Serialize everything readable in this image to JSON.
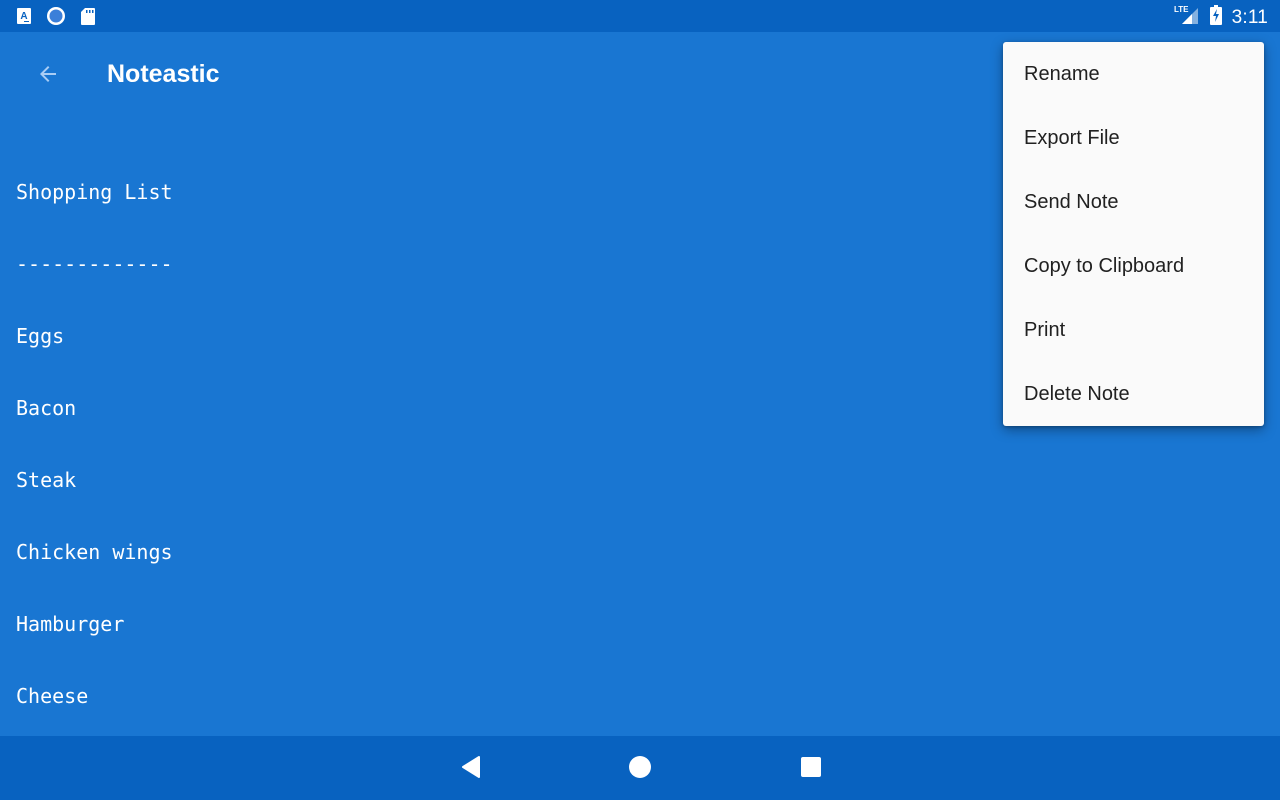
{
  "status_bar": {
    "left_icons": [
      "app-notification-icon",
      "sync-circle-icon",
      "sd-card-icon"
    ],
    "right_icons": [
      "lte-signal-icon",
      "battery-charging-icon"
    ],
    "network_label": "LTE",
    "time": "3:11"
  },
  "app_bar": {
    "back_icon": "arrow-left-icon",
    "title": "Noteastic"
  },
  "note": {
    "lines": [
      "Shopping List",
      "-------------",
      "Eggs",
      "Bacon",
      "Steak",
      "Chicken wings",
      "Hamburger",
      "Cheese"
    ]
  },
  "overflow_menu": {
    "items": [
      {
        "label": "Rename"
      },
      {
        "label": "Export File"
      },
      {
        "label": "Send Note"
      },
      {
        "label": "Copy to Clipboard"
      },
      {
        "label": "Print"
      },
      {
        "label": "Delete Note"
      }
    ]
  },
  "nav_bar": {
    "buttons": [
      "back-triangle-icon",
      "home-circle-icon",
      "recents-square-icon"
    ]
  },
  "colors": {
    "primary": "#1976d2",
    "primary_dark": "#0862c0",
    "menu_bg": "#fafafa",
    "menu_text": "#212121"
  }
}
